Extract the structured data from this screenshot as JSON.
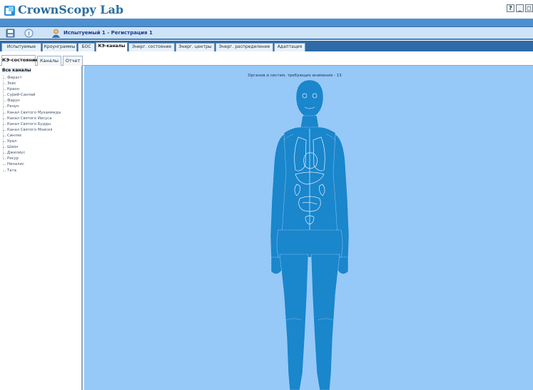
{
  "app": {
    "title": "CrownScopy Lab",
    "window_controls": [
      "?",
      "_",
      "◻"
    ]
  },
  "header": {
    "subject": "Испытуемый 1 - Регистрация 1",
    "icons": [
      "save-icon",
      "info-icon",
      "user-icon"
    ]
  },
  "main_tabs": [
    {
      "label": "Испытуемые",
      "active": false
    },
    {
      "label": "Кроунграммы",
      "active": false
    },
    {
      "label": "БОС",
      "active": false
    },
    {
      "label": "КЭ-каналы",
      "active": true
    },
    {
      "label": "Энерг. состояние",
      "active": false
    },
    {
      "label": "Энерг. центры",
      "active": false
    },
    {
      "label": "Энерг. распределение",
      "active": false
    },
    {
      "label": "Адаптация",
      "active": false
    }
  ],
  "sub_tabs": [
    {
      "label": "КЭ-состояние",
      "active": true
    },
    {
      "label": "Каналы",
      "active": false
    },
    {
      "label": "Отчет",
      "active": false
    }
  ],
  "sidebar": {
    "root": "Все каналы",
    "items": [
      "Фираст",
      "Зевс",
      "Краон",
      "Сурий-Санлай",
      "Фарун",
      "Ранун",
      "Канал Святого Мухаммеда",
      "Канал Святого Иисуса",
      "Канал Святого Будды",
      "Канал Святого Моисея",
      "Синлях",
      "Урал",
      "Шаон",
      "Джилиус",
      "Рисур",
      "Ниналис",
      "Тата"
    ]
  },
  "main": {
    "organs_message": "Органов и систем, требующих внимания - 13",
    "body_figure": "human-body-figure"
  },
  "colors": {
    "panel_bg": "#96c8f8",
    "body_fill": "#1a86cc",
    "header_band": "#4e90cf",
    "tab_bar": "#2e6aa8"
  }
}
